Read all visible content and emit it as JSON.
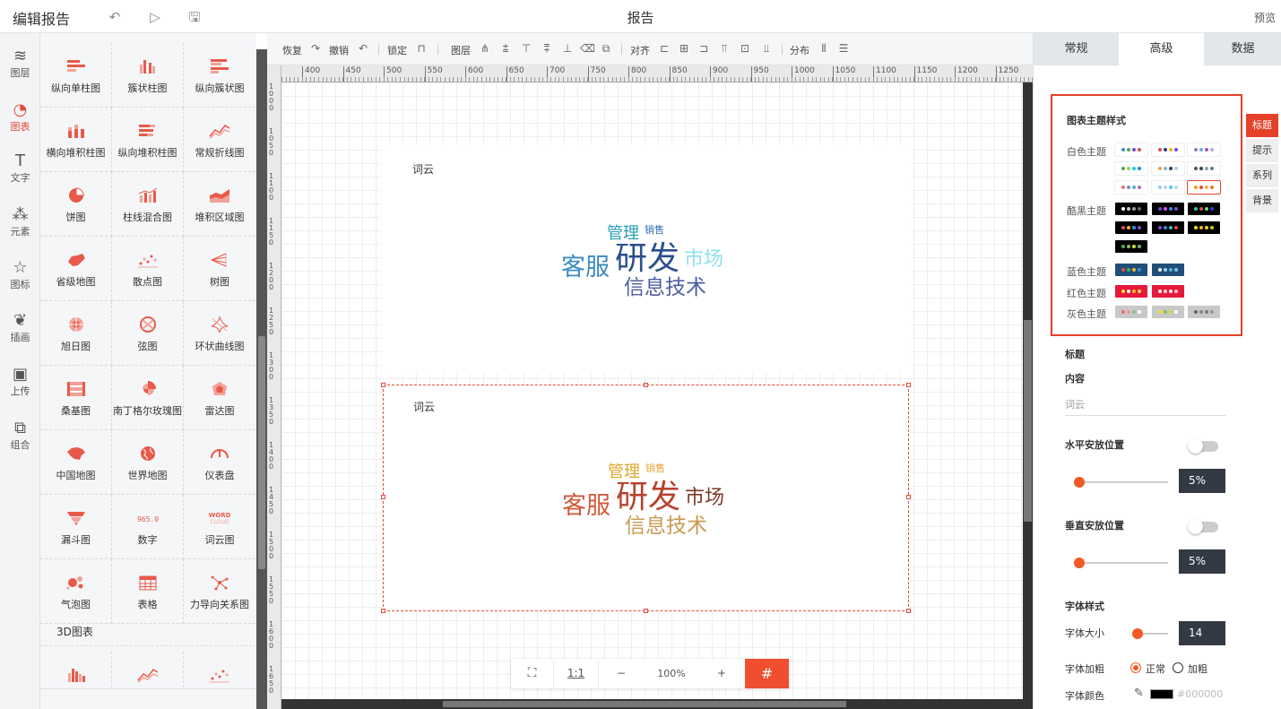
{
  "topbar": {
    "title": "编辑报告",
    "center_title": "报告",
    "preview": "预览"
  },
  "nav": {
    "items": [
      {
        "label": "图层",
        "icon": "layers-icon",
        "glyph": "≋"
      },
      {
        "label": "图表",
        "icon": "chart-pie-icon",
        "glyph": "◔"
      },
      {
        "label": "文字",
        "icon": "text-icon",
        "glyph": "T"
      },
      {
        "label": "元素",
        "icon": "shapes-icon",
        "glyph": "⁂"
      },
      {
        "label": "图标",
        "icon": "star-icon",
        "glyph": "☆"
      },
      {
        "label": "插画",
        "icon": "illustration-icon",
        "glyph": "❦"
      },
      {
        "label": "上传",
        "icon": "upload-image-icon",
        "glyph": "▣"
      },
      {
        "label": "组合",
        "icon": "combine-icon",
        "glyph": "⧉"
      }
    ]
  },
  "palette": {
    "items": [
      {
        "label": "纵向单柱图",
        "icon": "horizontal-bar-icon"
      },
      {
        "label": "簇状柱图",
        "icon": "cluster-column-icon"
      },
      {
        "label": "纵向簇状图",
        "icon": "horizontal-cluster-icon"
      },
      {
        "label": "横向堆积柱图",
        "icon": "stacked-column-icon"
      },
      {
        "label": "纵向堆积柱图",
        "icon": "stacked-bar-icon"
      },
      {
        "label": "常规折线图",
        "icon": "line-chart-icon"
      },
      {
        "label": "饼图",
        "icon": "pie-chart-icon"
      },
      {
        "label": "柱线混合图",
        "icon": "combo-chart-icon"
      },
      {
        "label": "堆积区域图",
        "icon": "area-chart-icon"
      },
      {
        "label": "省级地图",
        "icon": "province-map-icon"
      },
      {
        "label": "散点图",
        "icon": "scatter-icon"
      },
      {
        "label": "树图",
        "icon": "tree-icon"
      },
      {
        "label": "旭日图",
        "icon": "sunburst-icon"
      },
      {
        "label": "弦图",
        "icon": "chord-icon"
      },
      {
        "label": "环状曲线图",
        "icon": "ring-curve-icon"
      },
      {
        "label": "桑基图",
        "icon": "sankey-icon"
      },
      {
        "label": "南丁格尔玫瑰图",
        "icon": "rose-chart-icon"
      },
      {
        "label": "雷达图",
        "icon": "radar-icon"
      },
      {
        "label": "中国地图",
        "icon": "china-map-icon"
      },
      {
        "label": "世界地图",
        "icon": "world-map-icon"
      },
      {
        "label": "仪表盘",
        "icon": "gauge-icon"
      },
      {
        "label": "漏斗图",
        "icon": "funnel-icon"
      },
      {
        "label": "数字",
        "icon": "number-icon"
      },
      {
        "label": "词云图",
        "icon": "word-cloud-icon"
      },
      {
        "label": "气泡图",
        "icon": "bubble-icon"
      },
      {
        "label": "表格",
        "icon": "table-icon"
      },
      {
        "label": "力导向关系图",
        "icon": "force-graph-icon"
      }
    ],
    "number_icon_text": "(965.0)",
    "wordcloud_icon_text": [
      "WORD",
      "CLOUD"
    ],
    "section_3d": "3D图表",
    "items_3d": [
      {
        "icon": "bar-3d-icon"
      },
      {
        "icon": "line-3d-icon"
      },
      {
        "icon": "scatter-3d-icon"
      }
    ]
  },
  "toolbar": {
    "restore": "恢复",
    "undo": "撤销",
    "lock": "锁定",
    "layer": "图层",
    "align": "对齐",
    "distribute": "分布"
  },
  "ruler": {
    "h_ticks": [
      "400",
      "450",
      "500",
      "550",
      "600",
      "650",
      "700",
      "750",
      "800",
      "850",
      "900",
      "950",
      "1000",
      "1050",
      "1100",
      "1150",
      "1200",
      "1250"
    ],
    "v_ticks": [
      "1000",
      "1050",
      "1100",
      "1150",
      "1200",
      "1250",
      "1300",
      "1350",
      "1400",
      "1450",
      "1500",
      "1550",
      "1600",
      "1650"
    ]
  },
  "widgets": [
    {
      "title": "词云",
      "words": [
        {
          "text": "管理",
          "color": "#26a0b5"
        },
        {
          "text": "销售",
          "color": "#2f6fb0"
        },
        {
          "text": "客服",
          "color": "#3a8bc4"
        },
        {
          "text": "研发",
          "color": "#2b4f8c"
        },
        {
          "text": "市场",
          "color": "#8ee0f0"
        },
        {
          "text": "信息技术",
          "color": "#4d5ea3"
        }
      ]
    },
    {
      "title": "词云",
      "words": [
        {
          "text": "管理",
          "color": "#e0a52c"
        },
        {
          "text": "销售",
          "color": "#e6a33a"
        },
        {
          "text": "客服",
          "color": "#d2593a"
        },
        {
          "text": "研发",
          "color": "#b5432f"
        },
        {
          "text": "市场",
          "color": "#7a3a2a"
        },
        {
          "text": "信息技术",
          "color": "#c99a54"
        }
      ]
    }
  ],
  "zoom": {
    "one_to_one": "1:1",
    "minus": "−",
    "value": "100%",
    "plus": "+"
  },
  "panel": {
    "tabs": [
      "常规",
      "高级",
      "数据"
    ],
    "active_tab": 1,
    "theme_heading": "图表主题样式",
    "theme_groups": [
      {
        "label": "白色主题",
        "bg": "#ffffff",
        "rows": [
          [
            [
              "#3b8fd6",
              "#4cae4c",
              "#7b4bd3",
              "#e14c4c"
            ],
            [
              "#e14c4c",
              "#2d3b8f",
              "#e7b82b",
              "#7b4bd3"
            ],
            [
              "#8e7cc3",
              "#6fa8dc",
              "#9b59b6",
              "#b4a7d6"
            ]
          ],
          [
            [
              "#4caf50",
              "#9ccc65",
              "#26c6da",
              "#1e88e5"
            ],
            [
              "#f0a05a",
              "#7fb3d5",
              "#2e4057",
              "#a9cce3"
            ],
            [
              "#455a64",
              "#37474f",
              "#90a4ae",
              "#607d8b"
            ]
          ],
          [
            [
              "#e57373",
              "#7986cb",
              "#4db6ac",
              "#ba68c8"
            ],
            [
              "#90caf9",
              "#c5cae9",
              "#4fc3f7",
              "#b2dfdb"
            ],
            [
              "#f39c12",
              "#e74c3c",
              "#f5b041",
              "#e67e22"
            ]
          ]
        ]
      },
      {
        "label": "酷黑主题",
        "bg": "#000000",
        "rows": [
          [
            [
              "#ffffff",
              "#cccccc",
              "#999999",
              "#666666"
            ],
            [
              "#5b4bd6",
              "#e14ce0",
              "#3b8fd6",
              "#7b4bd3"
            ],
            [
              "#2ec4b6",
              "#e14c4c",
              "#7bd389",
              "#3b3bd6"
            ]
          ],
          [
            [
              "#e14c4c",
              "#f7b32b",
              "#3b8fd6",
              "#7b4bd3"
            ],
            [
              "#7b4bd3",
              "#3b8fd6",
              "#2ec4b6",
              "#e14c4c"
            ],
            [
              "#f7e02b",
              "#f7b32b",
              "#e1d12b",
              "#cccc00"
            ]
          ],
          [
            [
              "#4caf50",
              "#8bc34a",
              "#cddc39",
              "#66bb6a"
            ]
          ]
        ]
      },
      {
        "label": "蓝色主题",
        "bg": "#1f4e79",
        "rows": [
          [
            [
              "#e14c4c",
              "#4cae4c",
              "#f7b32b",
              "#3b8fd6"
            ],
            [
              "#ffffff",
              "#a9cce3",
              "#5dade2",
              "#85c1e9"
            ]
          ]
        ]
      },
      {
        "label": "红色主题",
        "bg": "#e5193b",
        "rows": [
          [
            [
              "#f7e02b",
              "#ffffff",
              "#f7b32b",
              "#ffd54f"
            ],
            [
              "#ffffff",
              "#ffd6d6",
              "#ffeaea",
              "#ffc9c9"
            ]
          ]
        ]
      },
      {
        "label": "灰色主题",
        "bg": "#c8c8c8",
        "rows": [
          [
            [
              "#e57373",
              "#f48fb1",
              "#81c784",
              "#ffffff"
            ],
            [
              "#f7e02b",
              "#8bc34a",
              "#cddc39",
              "#ffffff"
            ],
            [
              "#666666",
              "#888888",
              "#777777",
              "#999999"
            ]
          ]
        ]
      }
    ],
    "side_tabs": [
      "标题",
      "提示",
      "系列",
      "背景"
    ],
    "title_label": "标题",
    "content_label": "内容",
    "content_value": "词云",
    "h_position": "水平安放位置",
    "h_value": "5%",
    "h_fraction": 0.05,
    "v_position": "垂直安放位置",
    "v_value": "5%",
    "v_fraction": 0.05,
    "font_style": "字体样式",
    "font_size_label": "字体大小",
    "font_size_value": "14",
    "font_size_fraction": 0.0,
    "font_bold_label": "字体加粗",
    "bold_normal": "正常",
    "bold_bold": "加粗",
    "font_color_label": "字体颜色",
    "font_color_value": "#000000"
  },
  "colors": {
    "accent": "#e5493a",
    "theme_border": "#e5402a",
    "slider_knob": "#f15a24"
  }
}
